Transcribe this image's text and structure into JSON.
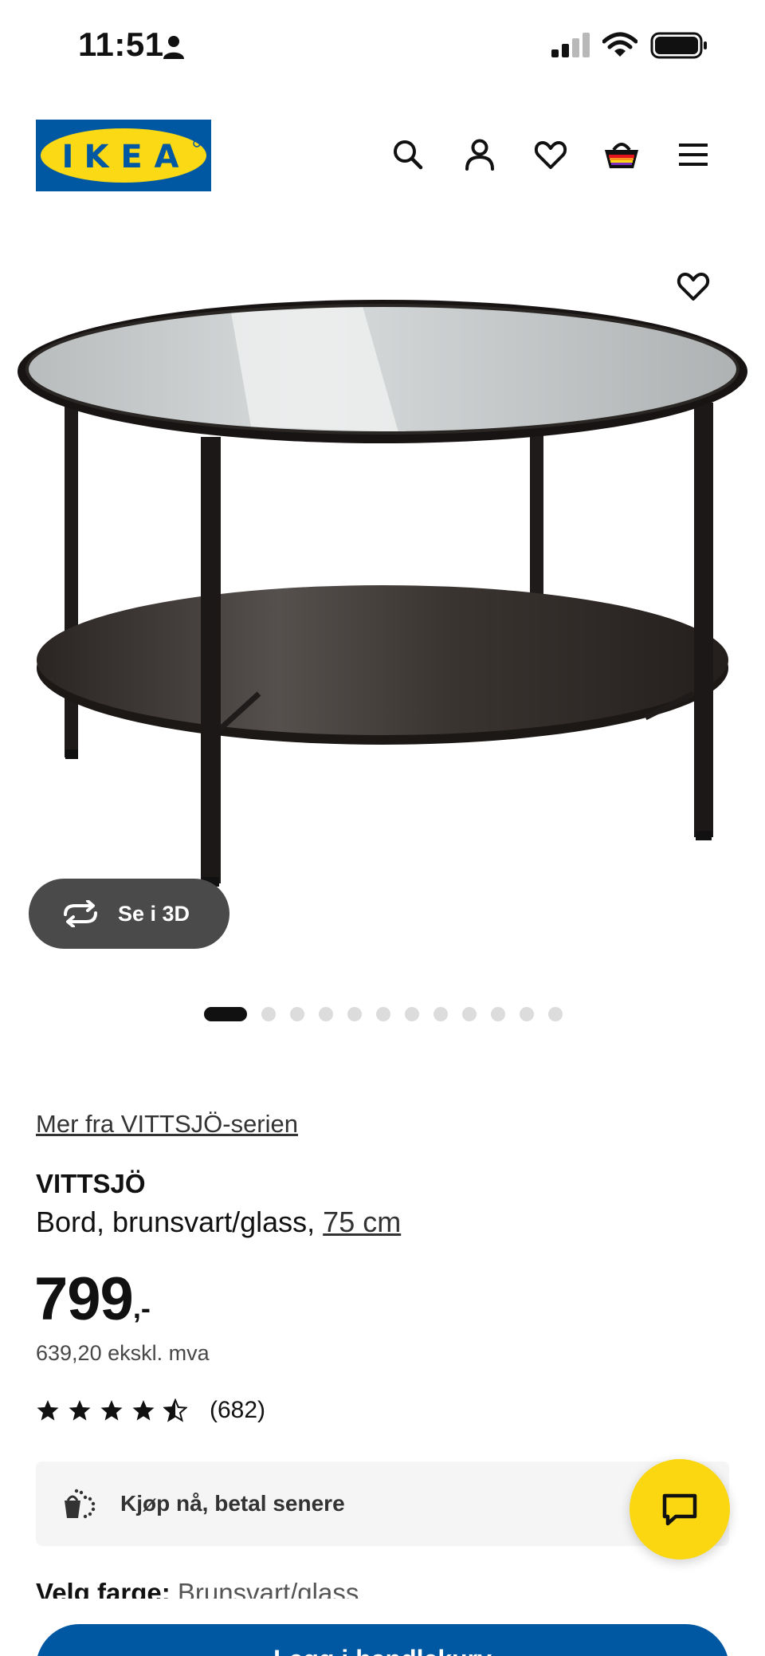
{
  "status_bar": {
    "time": "11:51"
  },
  "header": {
    "logo_text": "IKEA",
    "colors": {
      "logo_blue": "#0058a3",
      "logo_yellow": "#fbd914"
    }
  },
  "product_gallery": {
    "view_3d_label": "Se i 3D",
    "total_images": 12,
    "active_index": 0
  },
  "product": {
    "series_link": "Mer fra VITTSJÖ-serien",
    "name": "VITTSJÖ",
    "description": "Bord, brunsvart/glass, ",
    "size_link": "75 cm",
    "price": "799",
    "price_suffix": ",-",
    "price_ex_vat": "639,20 ekskl. mva",
    "rating": 4.5,
    "rating_count": "(682)"
  },
  "pay_later": {
    "label": "Kjøp nå, betal senere"
  },
  "color_select": {
    "label": "Velg farge:",
    "value": "Brunsvart/glass"
  },
  "cart": {
    "button_label": "Legg i handlekurv"
  },
  "colors": {
    "primary_blue": "#0058a3",
    "chat_yellow": "#fad710",
    "dark_button": "#4a4a4a"
  }
}
